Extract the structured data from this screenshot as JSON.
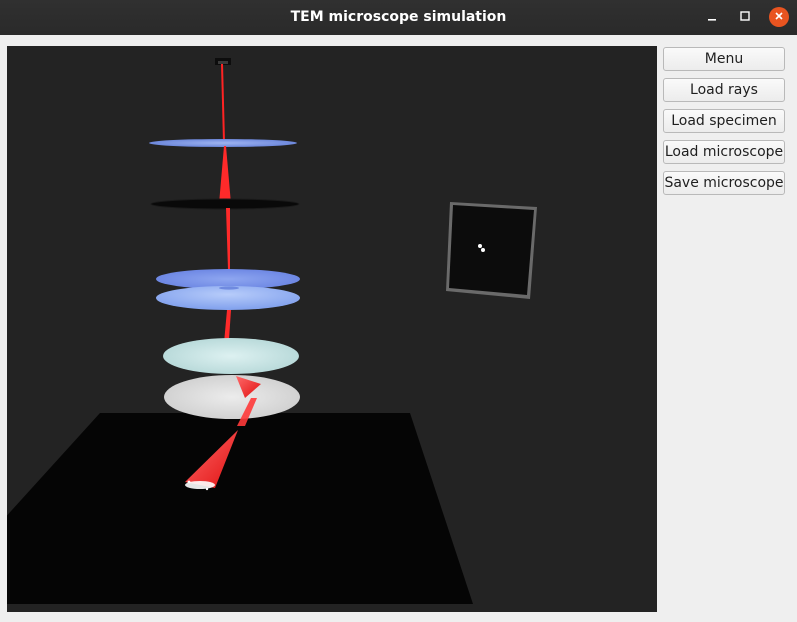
{
  "window": {
    "title": "TEM microscope simulation"
  },
  "sidebar": {
    "buttons": [
      {
        "label": "Menu"
      },
      {
        "label": "Load rays"
      },
      {
        "label": "Load specimen"
      },
      {
        "label": "Load microscope"
      },
      {
        "label": "Save microscope"
      }
    ]
  },
  "scene": {
    "background_color": "#232323",
    "ray_color": "#ff2a2a",
    "floor_color": "#050505",
    "lens_colors": [
      "#7f9ae8",
      "#0a0a0a",
      "#7f96ec",
      "#9ab4f4",
      "#c7e6e6",
      "#dadada"
    ]
  }
}
